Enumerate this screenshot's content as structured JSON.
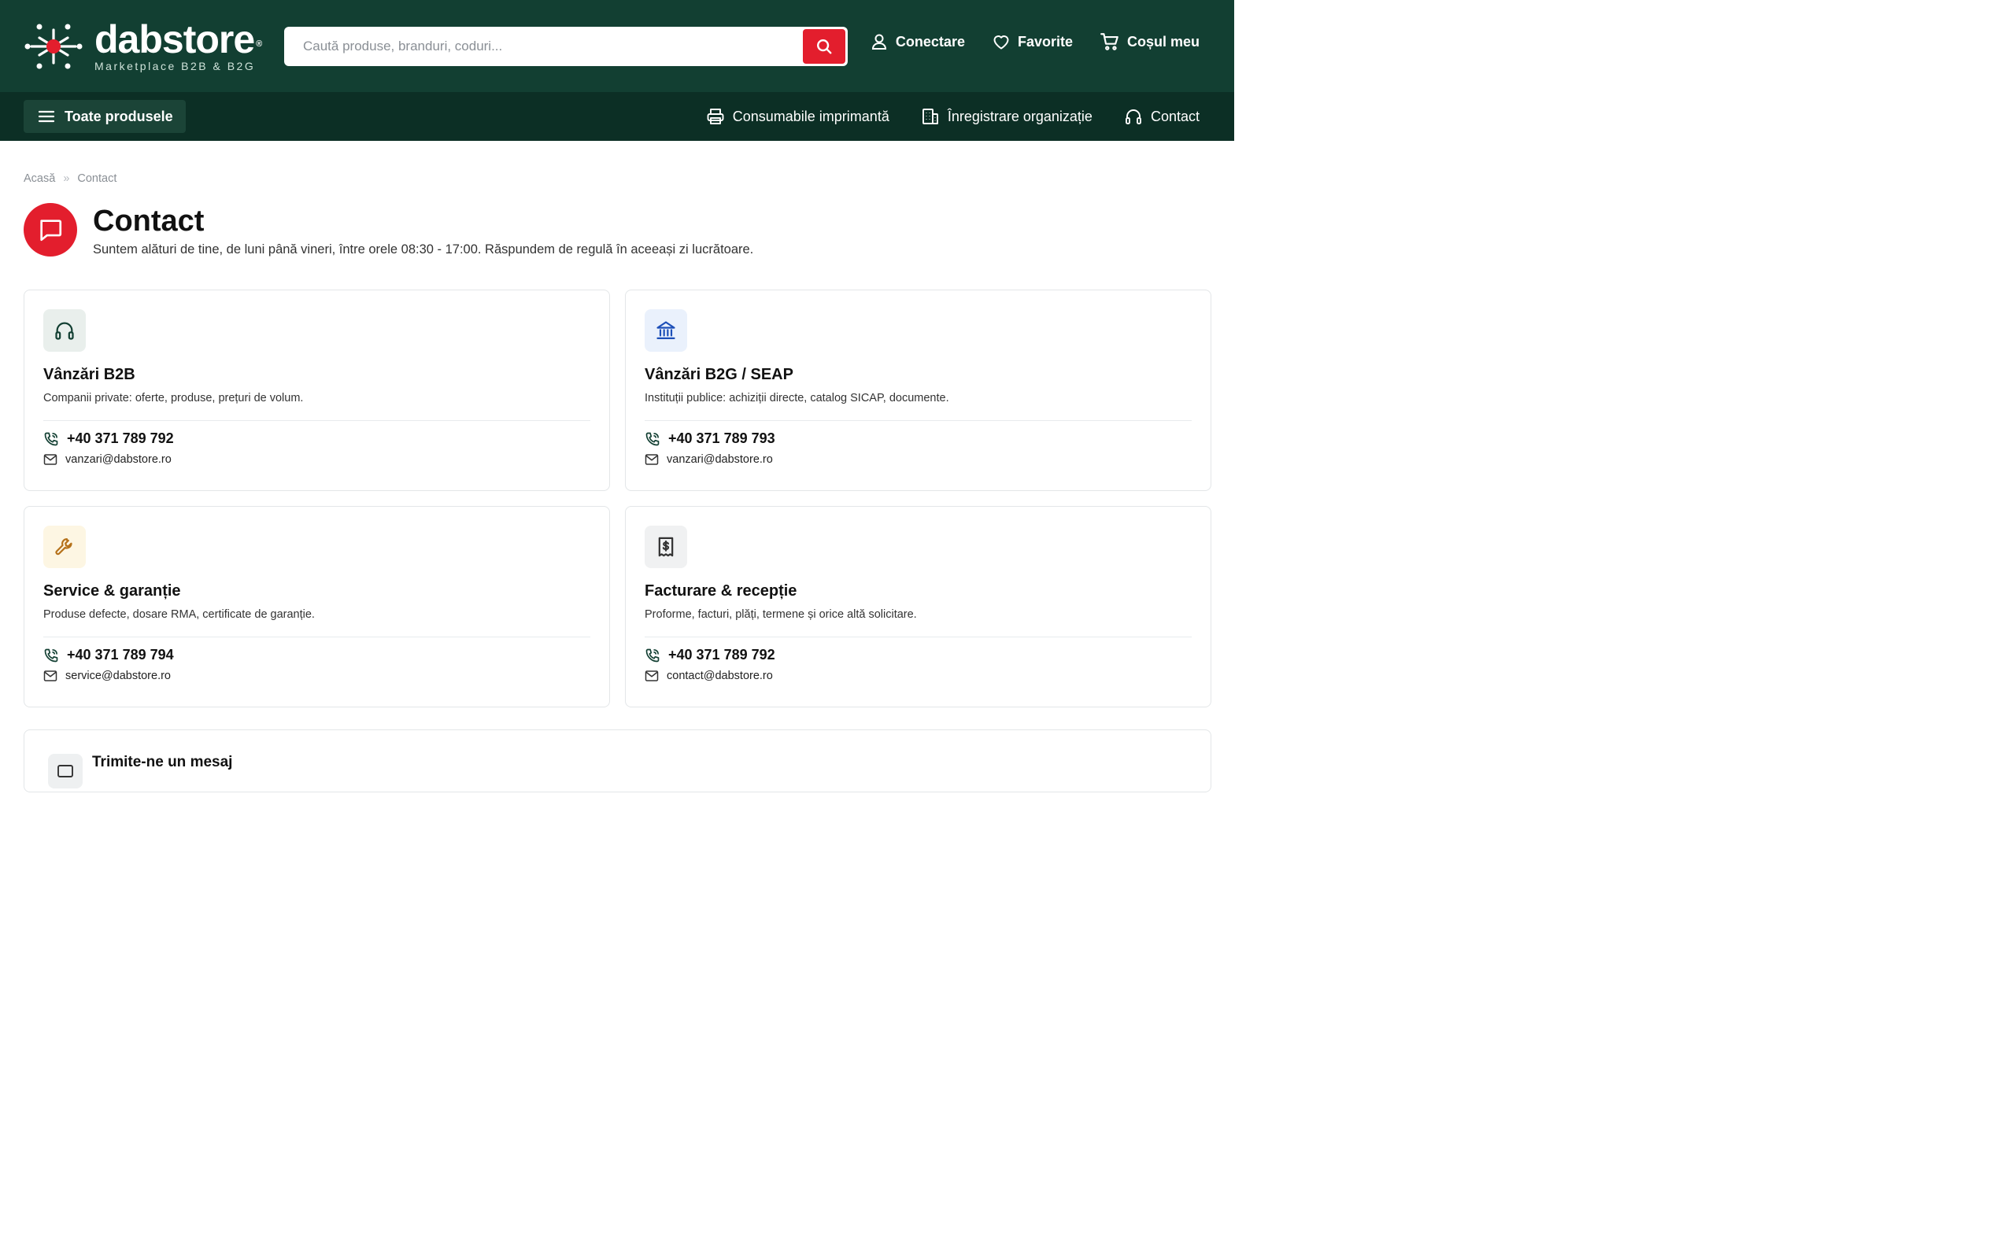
{
  "header": {
    "logo_name": "dabstore",
    "logo_registered": "®",
    "logo_tagline": "Marketplace B2B & B2G",
    "search_placeholder": "Caută produse, branduri, coduri...",
    "actions": [
      {
        "label": "Conectare",
        "icon": "user-icon"
      },
      {
        "label": "Favorite",
        "icon": "heart-icon"
      },
      {
        "label": "Coșul meu",
        "icon": "cart-icon"
      }
    ]
  },
  "nav": {
    "all_products": "Toate produsele",
    "links": [
      {
        "label": "Consumabile imprimantă",
        "icon": "printer-icon"
      },
      {
        "label": "Înregistrare organizație",
        "icon": "building-icon"
      },
      {
        "label": "Contact",
        "icon": "headset-icon"
      }
    ]
  },
  "breadcrumb": {
    "home": "Acasă",
    "separator": "»",
    "current": "Contact"
  },
  "page": {
    "title": "Contact",
    "subtitle": "Suntem alături de tine, de luni până vineri, între orele 08:30 - 17:00. Răspundem de regulă în aceeași zi lucrătoare."
  },
  "cards": [
    {
      "title": "Vânzări B2B",
      "desc": "Companii private: oferte, produse, prețuri de volum.",
      "phone": "+40 371 789 792",
      "email": "vanzari@dabstore.ro",
      "icon": "headset-icon",
      "icon_bg": "#e9efec",
      "icon_color": "#123f32"
    },
    {
      "title": "Vânzări B2G / SEAP",
      "desc": "Instituții publice: achiziții directe, catalog SICAP, documente.",
      "phone": "+40 371 789 793",
      "email": "vanzari@dabstore.ro",
      "icon": "bank-icon",
      "icon_bg": "#eaf1fc",
      "icon_color": "#1d4fb8"
    },
    {
      "title": "Service & garanție",
      "desc": "Produse defecte, dosare RMA, certificate de garanție.",
      "phone": "+40 371 789 794",
      "email": "service@dabstore.ro",
      "icon": "wrench-icon",
      "icon_bg": "#fdf6e3",
      "icon_color": "#b5711a"
    },
    {
      "title": "Facturare & recepție",
      "desc": "Proforme, facturi, plăți, termene și orice altă solicitare.",
      "phone": "+40 371 789 792",
      "email": "contact@dabstore.ro",
      "icon": "receipt-icon",
      "icon_bg": "#f0f1f2",
      "icon_color": "#333333"
    }
  ],
  "message_section": {
    "title": "Trimite-ne un mesaj"
  },
  "colors": {
    "header_bg": "#123f32",
    "nav_bg": "#0c2f25",
    "accent_red": "#e31e2d"
  }
}
